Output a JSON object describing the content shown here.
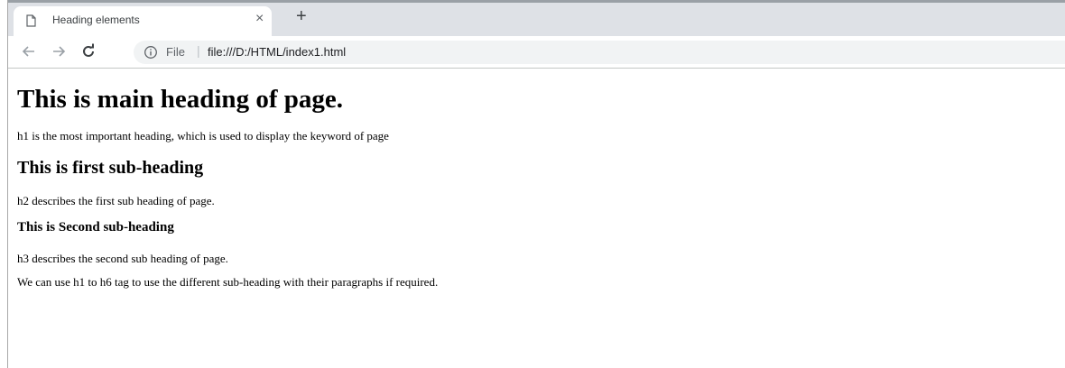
{
  "browser": {
    "tab_title": "Heading elements",
    "tab_close": "×",
    "new_tab": "+",
    "address": {
      "scheme_label": "File",
      "separator": "|",
      "url": "file:///D:/HTML/index1.html"
    }
  },
  "page": {
    "h1": "This is main heading of page.",
    "p1": "h1 is the most important heading, which is used to display the keyword of page",
    "h2": "This is first sub-heading",
    "p2": "h2 describes the first sub heading of page.",
    "h3": "This is Second sub-heading",
    "p3": "h3 describes the second sub heading of page.",
    "p4": "We can use h1 to h6 tag to use the different sub-heading with their paragraphs if required."
  }
}
